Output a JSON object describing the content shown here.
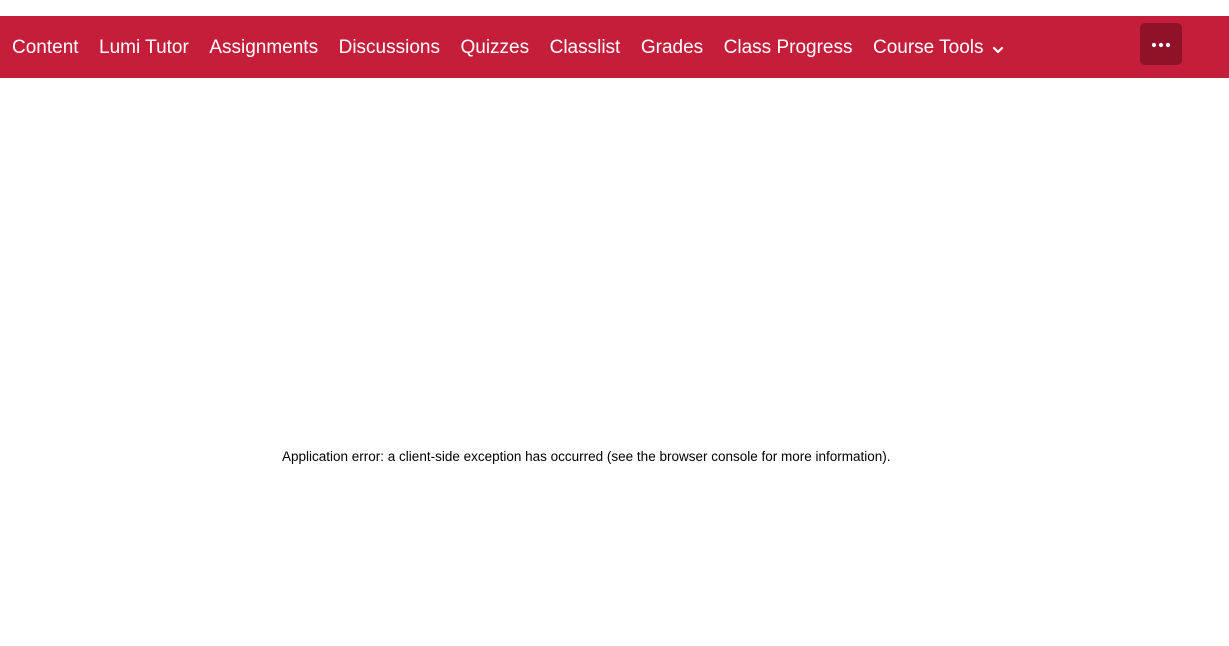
{
  "colors": {
    "navbar_bg": "#c41e3a",
    "more_button_bg": "#8f1228",
    "nav_text": "#ffffff"
  },
  "navbar": {
    "items": [
      {
        "label": "Content"
      },
      {
        "label": "Lumi Tutor"
      },
      {
        "label": "Assignments"
      },
      {
        "label": "Discussions"
      },
      {
        "label": "Quizzes"
      },
      {
        "label": "Classlist"
      },
      {
        "label": "Grades"
      },
      {
        "label": "Class Progress"
      },
      {
        "label": "Course Tools",
        "icon": "chevron-down-icon"
      }
    ],
    "more_button_icon": "more-horizontal-icon"
  },
  "main": {
    "error_message": "Application error: a client-side exception has occurred (see the browser console for more information)."
  }
}
